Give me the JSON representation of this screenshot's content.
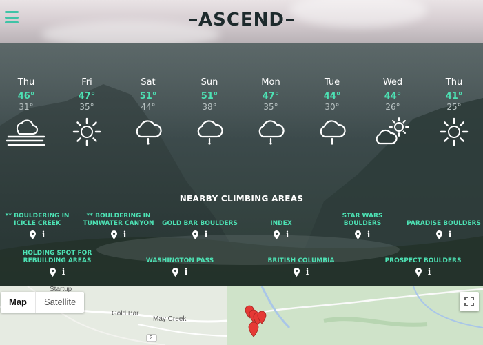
{
  "header": {
    "logo_text": "ASCEND",
    "menu_icon": "hamburger-menu-icon",
    "colors": {
      "accent": "#3fc3a6",
      "logo": "#1d2a2c"
    }
  },
  "forecast": [
    {
      "day": "Thu",
      "high": "46°",
      "low": "31°",
      "icon": "fog-icon"
    },
    {
      "day": "Fri",
      "high": "47°",
      "low": "35°",
      "icon": "sun-icon"
    },
    {
      "day": "Sat",
      "high": "51°",
      "low": "44°",
      "icon": "rain-cloud-icon"
    },
    {
      "day": "Sun",
      "high": "51°",
      "low": "38°",
      "icon": "rain-cloud-icon"
    },
    {
      "day": "Mon",
      "high": "47°",
      "low": "35°",
      "icon": "rain-cloud-icon"
    },
    {
      "day": "Tue",
      "high": "44°",
      "low": "30°",
      "icon": "rain-cloud-icon"
    },
    {
      "day": "Wed",
      "high": "44°",
      "low": "26°",
      "icon": "partly-cloudy-icon"
    },
    {
      "day": "Thu",
      "high": "41°",
      "low": "25°",
      "icon": "sun-icon"
    }
  ],
  "areas": {
    "title": "NEARBY CLIMBING AREAS",
    "items": [
      {
        "name_lines": [
          "** BOULDERING IN",
          "ICICLE CREEK"
        ]
      },
      {
        "name_lines": [
          "** BOULDERING IN",
          "TUMWATER CANYON"
        ]
      },
      {
        "name_lines": [
          "GOLD BAR BOULDERS"
        ]
      },
      {
        "name_lines": [
          "INDEX"
        ]
      },
      {
        "name_lines": [
          "STAR WARS",
          "BOULDERS"
        ]
      },
      {
        "name_lines": [
          "PARADISE BOULDERS"
        ]
      },
      {
        "name_lines": [
          "HOLDING SPOT FOR",
          "REBUILDING AREAS"
        ]
      },
      {
        "name_lines": [
          "WASHINGTON PASS"
        ]
      },
      {
        "name_lines": [
          "BRITISH COLUMBIA"
        ]
      },
      {
        "name_lines": [
          "PROSPECT BOULDERS"
        ]
      }
    ],
    "accent_color": "#4de2b4"
  },
  "map": {
    "map_button": "Map",
    "satellite_button": "Satellite",
    "labels": {
      "startup": "Startup",
      "gold_bar": "Gold Bar",
      "may_creek": "May Creek",
      "route": "2"
    },
    "fullscreen_icon": "fullscreen-icon",
    "marker_color": "#e53935"
  }
}
